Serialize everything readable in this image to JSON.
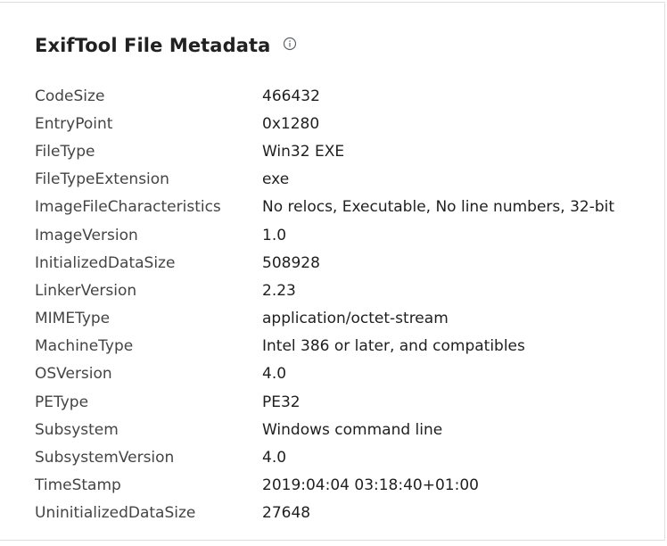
{
  "panel": {
    "title": "ExifTool File Metadata",
    "info_icon": "info-circle-icon"
  },
  "metadata": [
    {
      "key": "CodeSize",
      "value": "466432"
    },
    {
      "key": "EntryPoint",
      "value": "0x1280"
    },
    {
      "key": "FileType",
      "value": "Win32 EXE"
    },
    {
      "key": "FileTypeExtension",
      "value": "exe"
    },
    {
      "key": "ImageFileCharacteristics",
      "value": "No relocs, Executable, No line numbers, 32-bit"
    },
    {
      "key": "ImageVersion",
      "value": "1.0"
    },
    {
      "key": "InitializedDataSize",
      "value": "508928"
    },
    {
      "key": "LinkerVersion",
      "value": "2.23"
    },
    {
      "key": "MIMEType",
      "value": "application/octet-stream"
    },
    {
      "key": "MachineType",
      "value": "Intel 386 or later, and compatibles"
    },
    {
      "key": "OSVersion",
      "value": "4.0"
    },
    {
      "key": "PEType",
      "value": "PE32"
    },
    {
      "key": "Subsystem",
      "value": "Windows command line"
    },
    {
      "key": "SubsystemVersion",
      "value": "4.0"
    },
    {
      "key": "TimeStamp",
      "value": "2019:04:04 03:18:40+01:00"
    },
    {
      "key": "UninitializedDataSize",
      "value": "27648"
    }
  ]
}
